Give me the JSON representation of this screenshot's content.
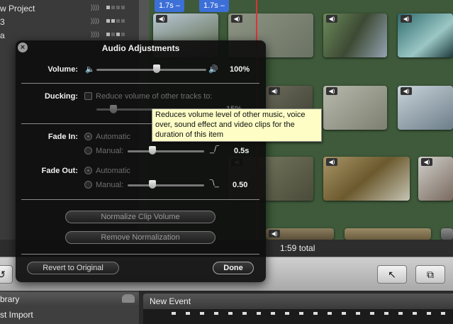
{
  "projects": [
    {
      "label": "w Project"
    },
    {
      "label": "3"
    },
    {
      "label": "a"
    }
  ],
  "timeline": {
    "range_tags": [
      "1.7s –",
      "1.7s –"
    ],
    "total": "1:59 total"
  },
  "library": {
    "header": "brary",
    "item": "st Import"
  },
  "events": {
    "header": "New Event"
  },
  "toolbar": {
    "pointer_icon": "↖",
    "crop_icon": "⧉"
  },
  "dialog": {
    "title": "Audio Adjustments",
    "volume": {
      "label": "Volume:",
      "value": "100%",
      "level": 0.55,
      "speaker_low_icon": "🔈",
      "speaker_high_icon": "🔊"
    },
    "ducking": {
      "label": "Ducking:",
      "checkbox_label": "Reduce volume of other tracks to:",
      "value": "15%",
      "checked": false,
      "level": 0.15
    },
    "fade_in": {
      "label": "Fade In:",
      "automatic_label": "Automatic",
      "manual_label": "Manual:",
      "value": "0.5s",
      "selected": "automatic"
    },
    "fade_out": {
      "label": "Fade Out:",
      "automatic_label": "Automatic",
      "manual_label": "Manual:",
      "value": "0.50",
      "selected": "automatic"
    },
    "normalize_button": "Normalize Clip Volume",
    "remove_normalization_button": "Remove Normalization",
    "revert_button": "Revert to Original",
    "done_button": "Done"
  },
  "tooltip": {
    "text": "Reduces volume level of other music, voice over, sound effect and video clips for the duration of this item"
  },
  "colors": {
    "event_background": "#3e5a3a",
    "range_tag": "#3d6fd8",
    "playhead": "#dd3333",
    "tooltip_bg": "#fdfdc5"
  }
}
